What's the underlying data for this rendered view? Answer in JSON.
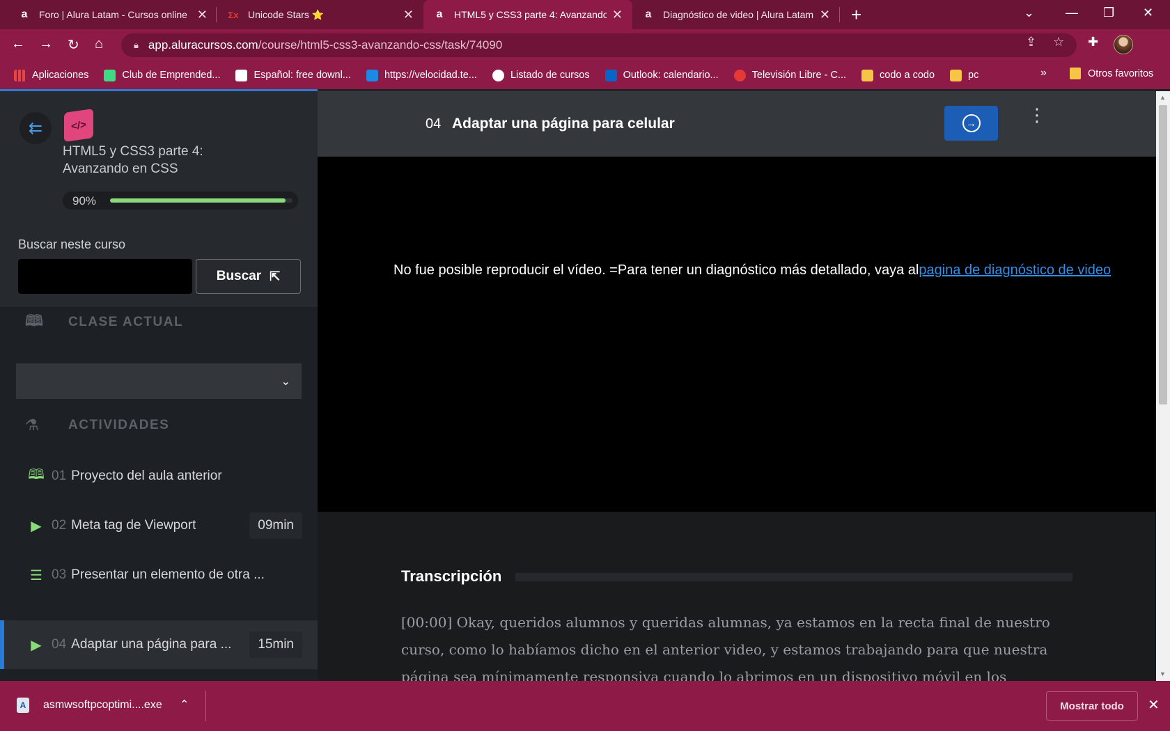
{
  "browser": {
    "tabs": [
      {
        "title": "Foro | Alura Latam - Cursos online",
        "favicon": "a"
      },
      {
        "title": "Unicode Stars ⭐",
        "favicon": "Σx"
      },
      {
        "title": "HTML5 y CSS3 parte 4: Avanzando",
        "favicon": "a"
      },
      {
        "title": "Diagnóstico de video | Alura Latam",
        "favicon": "a"
      }
    ],
    "url_host": "app.aluracursos.com",
    "url_path": "/course/html5-css3-avanzando-css/task/74090",
    "bookmarks": [
      {
        "label": "Aplicaciones",
        "color": "#e8453c"
      },
      {
        "label": "Club de Emprended...",
        "color": "#3ddc84"
      },
      {
        "label": "Español: free downl...",
        "color": "#ffffff"
      },
      {
        "label": "https://velocidad.te...",
        "color": "#1e88e5"
      },
      {
        "label": "Listado de cursos",
        "color": "#ffffff"
      },
      {
        "label": "Outlook: calendario...",
        "color": "#0a64c8"
      },
      {
        "label": "Televisión Libre - C...",
        "color": "#e53935"
      },
      {
        "label": "codo a codo",
        "color": "#f6c545"
      },
      {
        "label": "pc",
        "color": "#f6c545"
      }
    ],
    "bookmarks_more": "»",
    "other_bookmarks": "Otros favoritos"
  },
  "sidebar": {
    "course_title": "HTML5 y CSS3 parte 4: Avanzando en CSS",
    "progress_label": "90%",
    "progress_value": 0.96,
    "search_label": "Buscar neste curso",
    "search_value": "",
    "search_button": "Buscar",
    "current_class_heading": "CLASE ACTUAL",
    "activities_heading": "ACTIVIDADES",
    "activities": [
      {
        "num": "01",
        "title": "Proyecto del aula anterior",
        "duration": "",
        "icon": "book-icon"
      },
      {
        "num": "02",
        "title": "Meta tag de Viewport",
        "duration": "09min",
        "icon": "play-icon"
      },
      {
        "num": "03",
        "title": "Presentar un elemento de otra ...",
        "duration": "",
        "icon": "list-icon"
      },
      {
        "num": "04",
        "title": "Adaptar una página para ...",
        "duration": "15min",
        "icon": "play-icon"
      }
    ]
  },
  "main": {
    "task_number": "04",
    "task_title": "Adaptar una página para celular",
    "video_message": "No fue posible reproducir el vídeo. =Para tener un diagnóstico más detallado, vaya al",
    "video_link": "pagina de diagnóstico de video",
    "transcription_heading": "Transcripción",
    "transcription_text": "[00:00] Okay, queridos alumnos y queridas alumnas, ya estamos en la recta final de nuestro curso, como lo habíamos dicho en el anterior video, y estamos trabajando para que nuestra página sea mínimamente responsiva cuando lo abrimos en un dispositivo móvil en los"
  },
  "downloads": {
    "file_name": "asmwsoftpcoptimi....exe",
    "show_all": "Mostrar todo"
  },
  "colors": {
    "chrome": "#8e1a48",
    "accent_blue": "#1c5eb5",
    "progress_green": "#8ad97a"
  }
}
